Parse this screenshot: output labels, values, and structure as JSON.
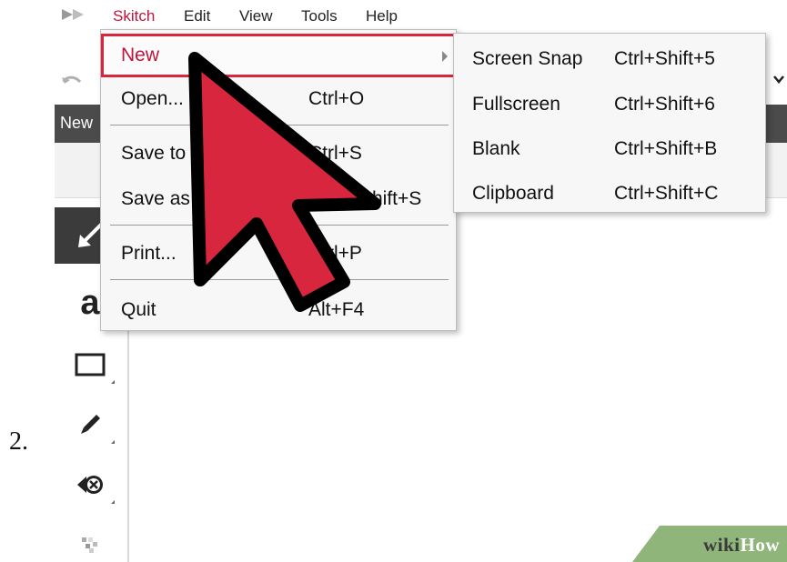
{
  "step": {
    "number": "2."
  },
  "menubar": {
    "items": [
      {
        "label": "Skitch",
        "active": true
      },
      {
        "label": "Edit"
      },
      {
        "label": "View"
      },
      {
        "label": "Tools"
      },
      {
        "label": "Help"
      }
    ]
  },
  "tabstrip": {
    "label": "New"
  },
  "file_menu": {
    "items": [
      {
        "label": "New",
        "shortcut": "",
        "has_submenu": true,
        "highlighted": true
      },
      {
        "label": "Open...",
        "shortcut": "Ctrl+O"
      },
      {
        "label": "Save to",
        "shortcut": "Ctrl+S"
      },
      {
        "label": "Save as",
        "shortcut": "Shift+S"
      },
      {
        "label": "Print...",
        "shortcut": "Ctrl+P"
      },
      {
        "label": "Quit",
        "shortcut": "Alt+F4"
      }
    ]
  },
  "new_submenu": {
    "items": [
      {
        "label": "Screen Snap",
        "shortcut": "Ctrl+Shift+5"
      },
      {
        "label": "Fullscreen",
        "shortcut": "Ctrl+Shift+6"
      },
      {
        "label": "Blank",
        "shortcut": "Ctrl+Shift+B"
      },
      {
        "label": "Clipboard",
        "shortcut": "Ctrl+Shift+C"
      }
    ]
  },
  "tools": {
    "items": [
      {
        "icon": "arrow-tool-icon",
        "selected": true
      },
      {
        "icon": "text-tool-icon",
        "glyph": "a"
      },
      {
        "icon": "rectangle-tool-icon"
      },
      {
        "icon": "marker-tool-icon"
      },
      {
        "icon": "stamp-tool-icon"
      },
      {
        "icon": "pixelate-tool-icon"
      }
    ]
  },
  "watermark": {
    "part1": "wiki",
    "part2": "How"
  },
  "colors": {
    "accent": "#c0143c",
    "cursor_fill": "#d7263d",
    "tabstrip": "#4b4b4b"
  }
}
